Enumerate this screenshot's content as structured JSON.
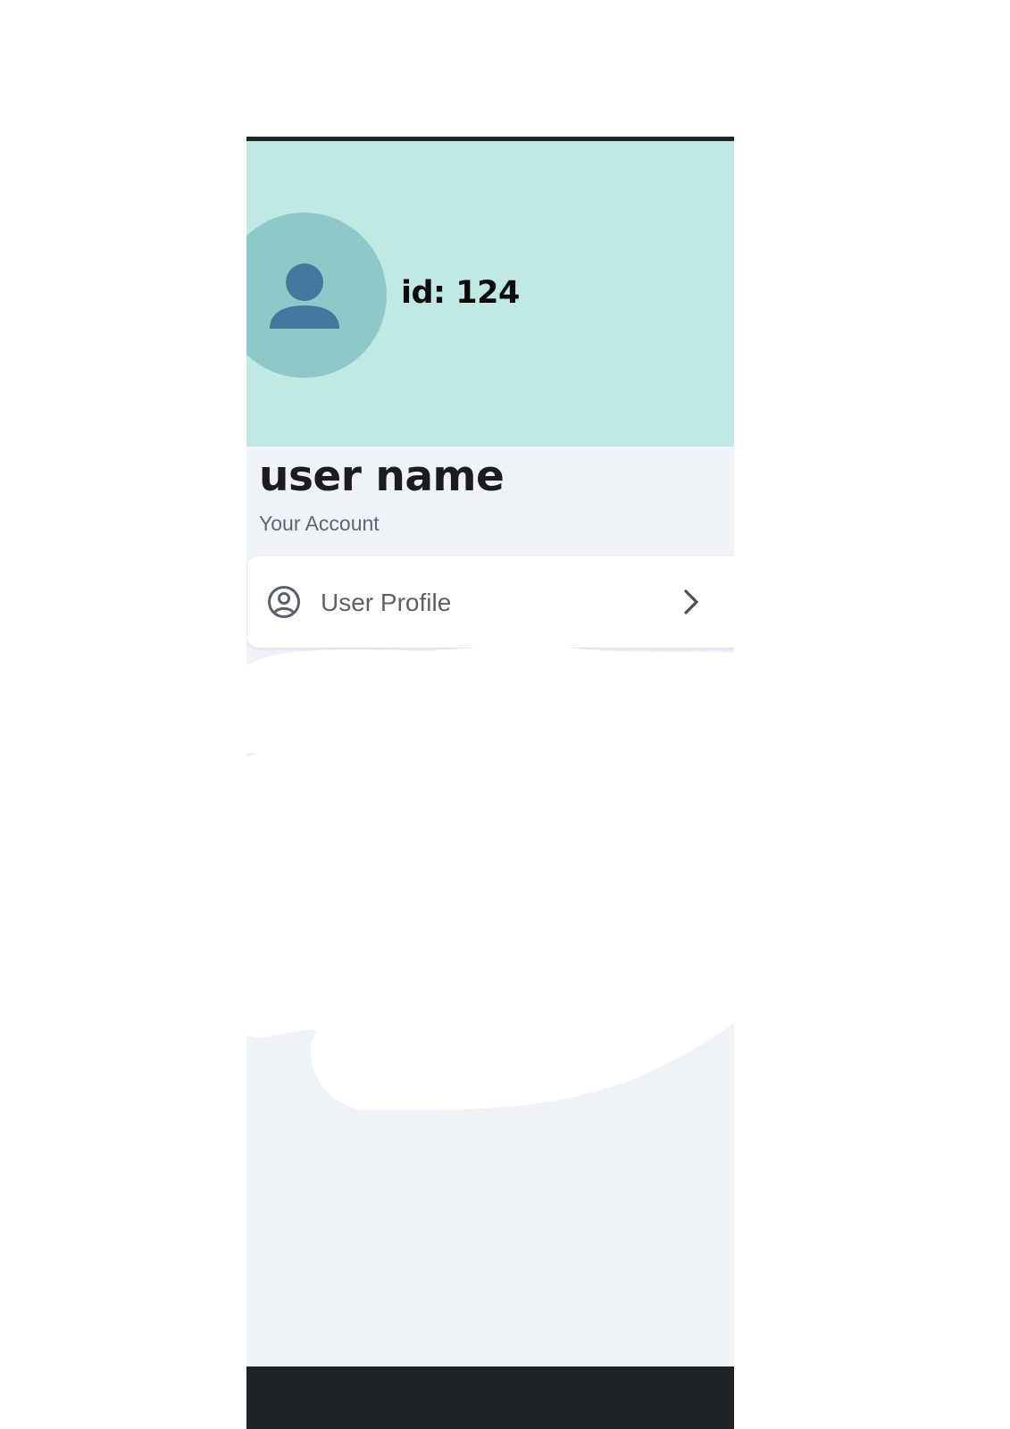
{
  "header": {
    "user_id": "id: 124",
    "background_color": "#c0e8e4",
    "avatar_color": "#8ec8c8",
    "avatar_icon": "person-icon",
    "avatar_icon_color": "#44789e"
  },
  "profile": {
    "user_name": "user name",
    "section_label": "Your Account"
  },
  "menu": {
    "items": [
      {
        "label": "User Profile",
        "icon": "account-circle-icon",
        "trailing_icon": "chevron-right-icon"
      }
    ]
  },
  "colors": {
    "page_background": "#eff3f8",
    "system_bars": "#1f2328",
    "card_background": "#ffffff"
  }
}
